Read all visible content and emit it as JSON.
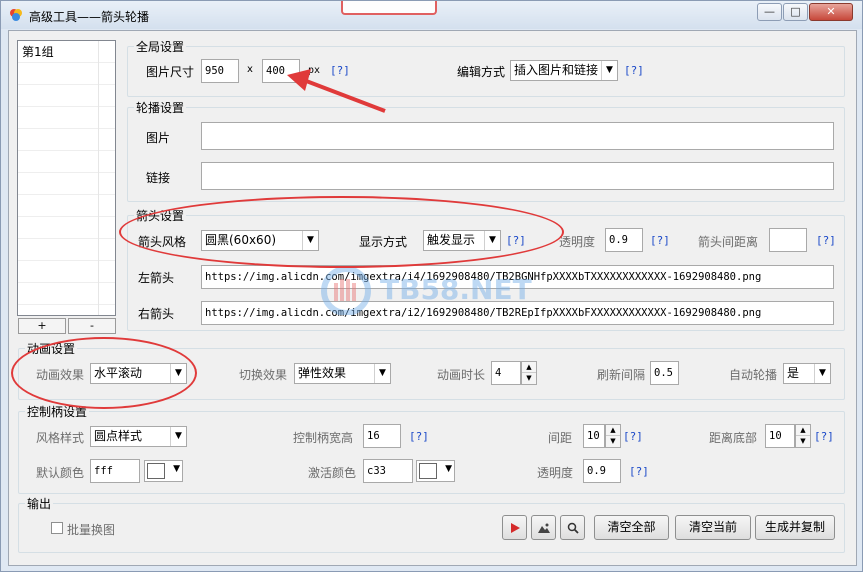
{
  "window": {
    "title": "高级工具——箭头轮播",
    "buttons": {
      "minimize": "—",
      "maximize": "□",
      "close": "✕"
    }
  },
  "sidebar": {
    "items": [
      {
        "label": "第1组"
      }
    ],
    "add_label": "+",
    "remove_label": "-"
  },
  "global": {
    "legend": "全局设置",
    "size_label": "图片尺寸",
    "width": "950",
    "x_label": "x",
    "height": "400",
    "unit": "px",
    "help": "[?]",
    "edit_label": "编辑方式",
    "edit_value": "插入图片和链接",
    "edit_help": "[?]"
  },
  "carousel": {
    "legend": "轮播设置",
    "image_label": "图片",
    "image_value": "",
    "link_label": "链接",
    "link_value": ""
  },
  "arrow": {
    "legend": "箭头设置",
    "style_label": "箭头风格",
    "style_value": "圆黑(60x60)",
    "display_label": "显示方式",
    "display_value": "触发显示",
    "display_help": "[?]",
    "opacity_label": "透明度",
    "opacity_value": "0.9",
    "opacity_help": "[?]",
    "gap_label": "箭头间距离",
    "gap_value": "",
    "gap_help": "[?]",
    "left_label": "左箭头",
    "left_value": "https://img.alicdn.com/imgextra/i4/1692908480/TB2BGNHfpXXXXbTXXXXXXXXXXXX-1692908480.png",
    "right_label": "右箭头",
    "right_value": "https://img.alicdn.com/imgextra/i2/1692908480/TB2REpIfpXXXXbFXXXXXXXXXXXX-1692908480.png"
  },
  "animation": {
    "legend": "动画设置",
    "effect_label": "动画效果",
    "effect_value": "水平滚动",
    "switch_label": "切换效果",
    "switch_value": "弹性效果",
    "duration_label": "动画时长",
    "duration_value": "4",
    "refresh_label": "刷新间隔",
    "refresh_value": "0.5",
    "auto_label": "自动轮播",
    "auto_value": "是"
  },
  "handle": {
    "legend": "控制柄设置",
    "style_label": "风格样式",
    "style_value": "圆点样式",
    "wh_label": "控制柄宽高",
    "wh_value": "16",
    "wh_help": "[?]",
    "spacing_label": "间距",
    "spacing_value": "10",
    "spacing_help": "[?]",
    "bottom_label": "距离底部",
    "bottom_value": "10",
    "bottom_help": "[?]",
    "default_color_label": "默认颜色",
    "default_color_value": "fff",
    "active_color_label": "激活颜色",
    "active_color_value": "c33",
    "opacity_label": "透明度",
    "opacity_value": "0.9",
    "opacity_help": "[?]"
  },
  "output": {
    "legend": "输出",
    "batch_label": "批量换图",
    "clear_all": "清空全部",
    "clear_current": "清空当前",
    "generate": "生成并复制"
  },
  "watermark": {
    "text": "TB58.NET"
  },
  "colors": {
    "annotation": "#e03a3a",
    "help_link": "#1b49c8",
    "play_icon": "#d42a2a"
  }
}
